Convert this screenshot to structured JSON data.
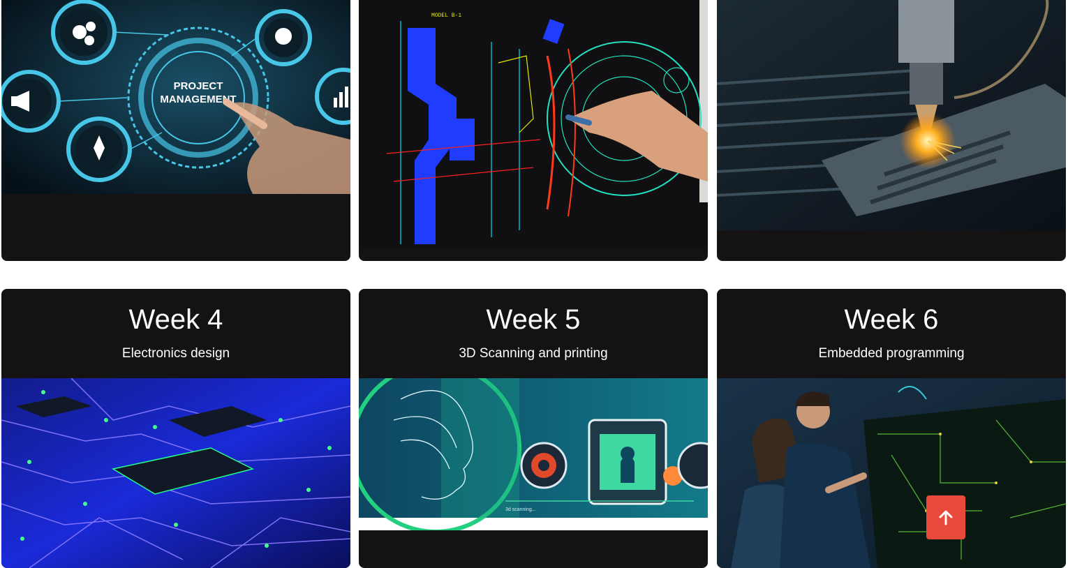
{
  "top_row": [
    {
      "image": "project-management-image",
      "label_visible": false
    },
    {
      "image": "cad-drawing-image",
      "label_visible": false
    },
    {
      "image": "laser-cutting-image",
      "label_visible": false
    }
  ],
  "weeks": [
    {
      "title": "Week 4",
      "subtitle": "Electronics design",
      "image": "circuit-board-image"
    },
    {
      "title": "Week 5",
      "subtitle": "3D Scanning and printing",
      "image": "3d-scanning-image"
    },
    {
      "title": "Week 6",
      "subtitle": "Embedded programming",
      "image": "embedded-programming-image"
    }
  ],
  "project_image_text": {
    "line1": "PROJECT",
    "line2": "MANAGEMENT"
  },
  "cad_image_text": "MODEL B-1",
  "scan_image_text": "3d scanning...",
  "scroll_top": {
    "icon": "arrow-up-icon",
    "color": "#e74a3b"
  }
}
